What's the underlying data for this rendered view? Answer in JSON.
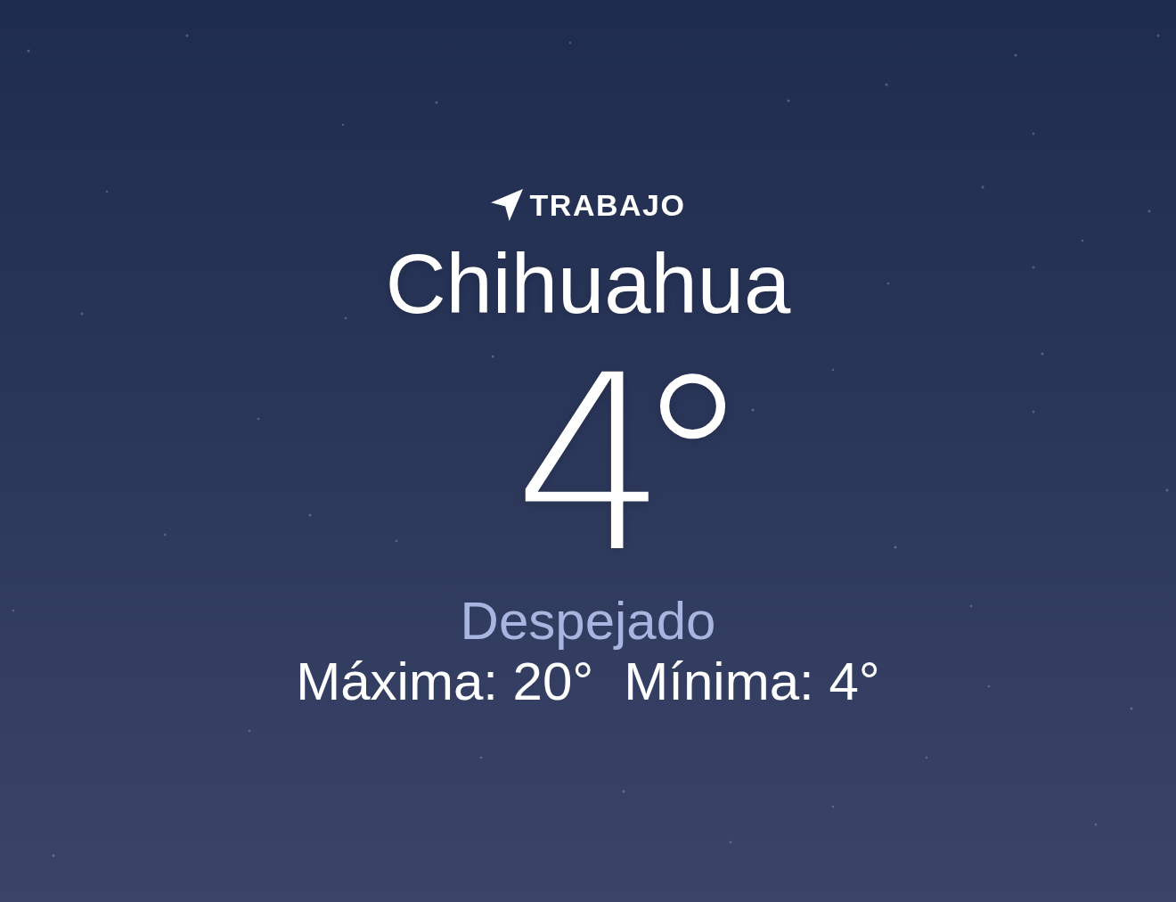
{
  "location": {
    "label": "TRABAJO"
  },
  "city": "Chihuahua",
  "temperature": "4°",
  "condition": "Despejado",
  "range": {
    "high": "Máxima: 20°",
    "low": "Mínima: 4°"
  }
}
